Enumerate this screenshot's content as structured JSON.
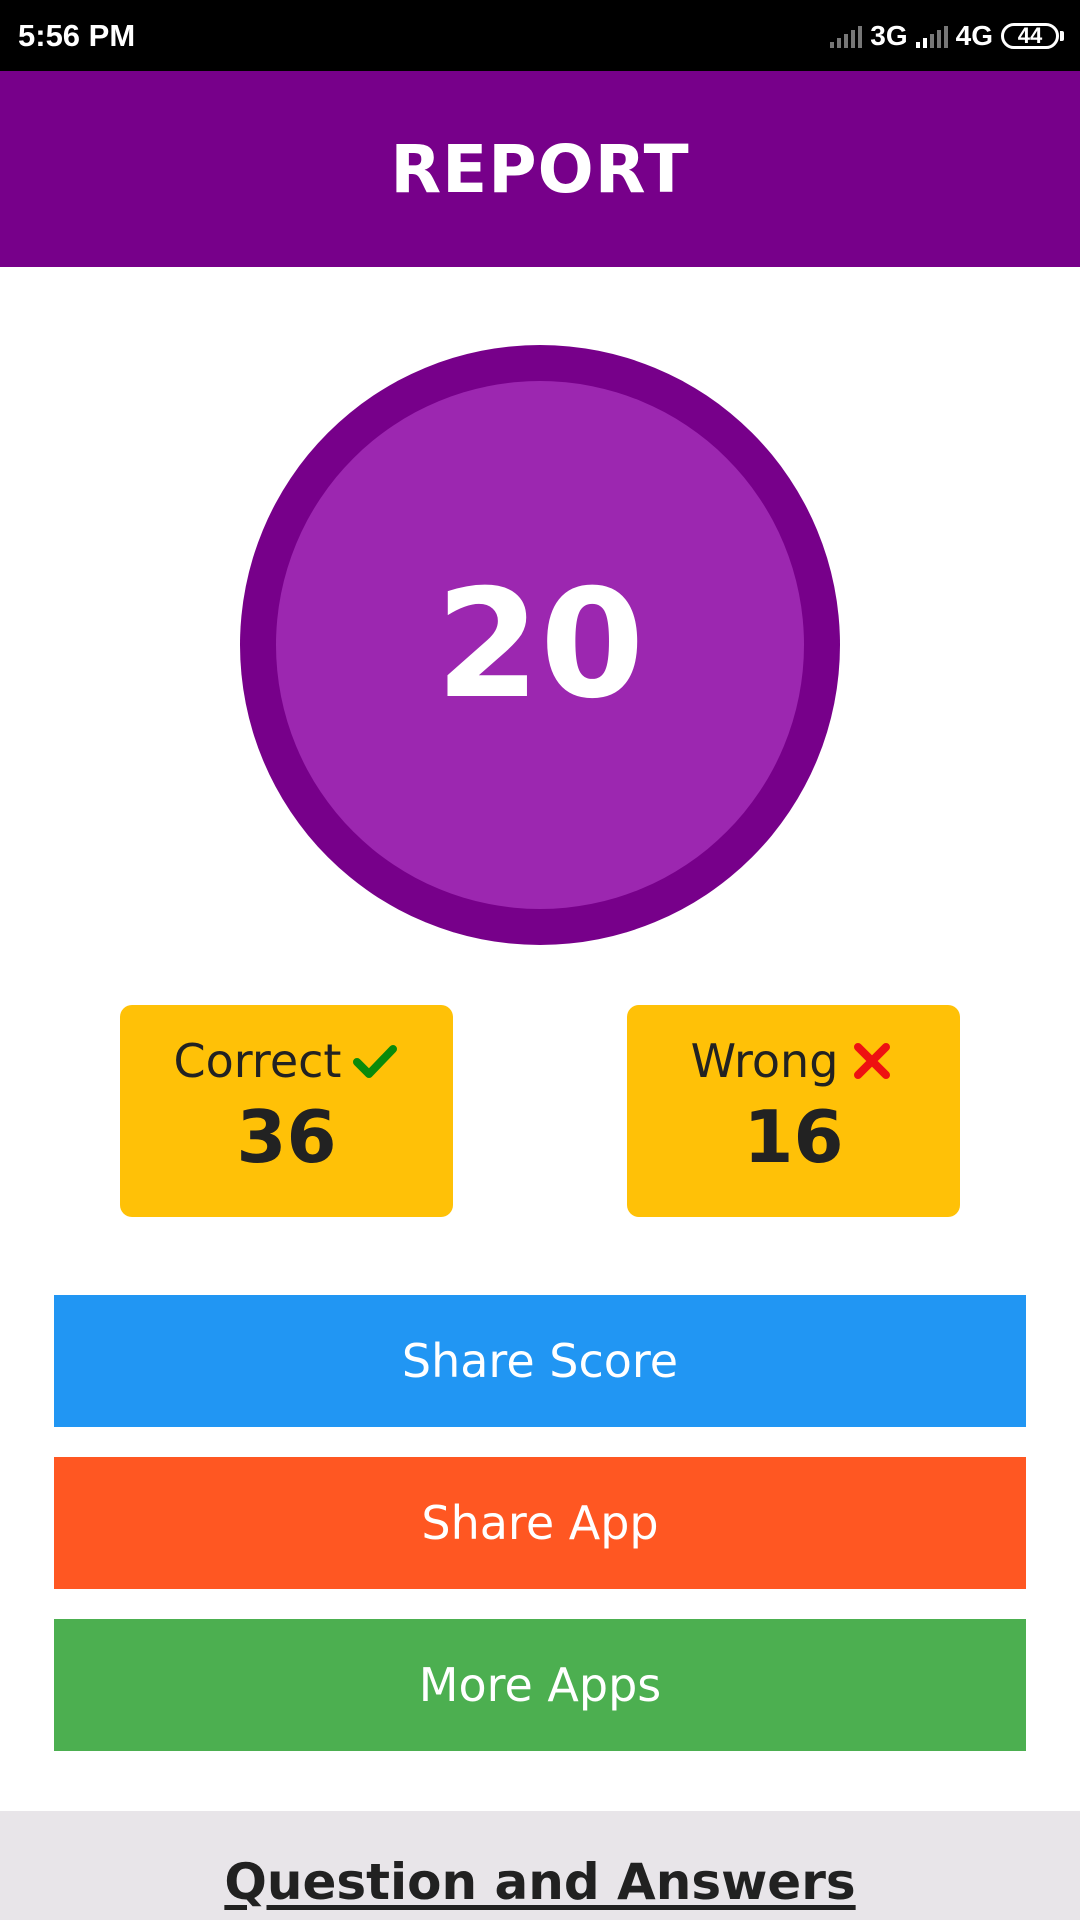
{
  "status_bar": {
    "time": "5:56 PM",
    "network_1": "3G",
    "network_2": "4G",
    "battery": "44",
    "icons": [
      "signal-icon",
      "signal-icon",
      "battery-icon"
    ]
  },
  "header": {
    "title": "REPORT"
  },
  "score": {
    "value": "20"
  },
  "stats": {
    "correct": {
      "label": "Correct",
      "value": "36",
      "icon": "check-icon",
      "icon_color": "#0a8a0a"
    },
    "wrong": {
      "label": "Wrong",
      "value": "16",
      "icon": "cross-icon",
      "icon_color": "#ee1111"
    }
  },
  "buttons": {
    "share_score": "Share Score",
    "share_app": "Share App",
    "more_apps": "More Apps"
  },
  "qa_section": {
    "title": "Question and Answers"
  },
  "colors": {
    "header": "#77008a",
    "score_ring": "#77008a",
    "score_fill": "#9c27b0",
    "stat_card": "#ffc107",
    "share_score": "#2196f3",
    "share_app": "#ff5722",
    "more_apps": "#4caf50",
    "qa_background": "#e8e5e9"
  }
}
